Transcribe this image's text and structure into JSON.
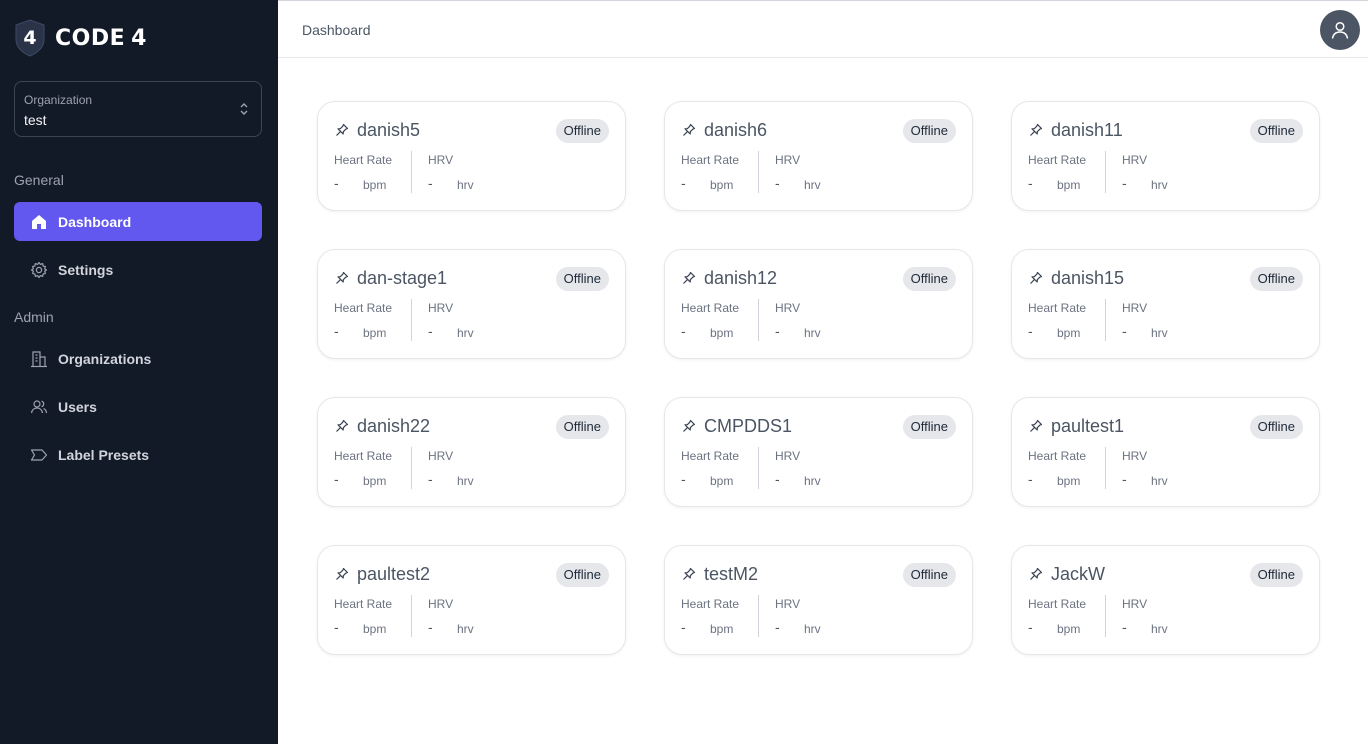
{
  "brand": {
    "name": "CODE",
    "number": "4"
  },
  "org_selector": {
    "label": "Organization",
    "value": "test"
  },
  "sidebar": {
    "general_title": "General",
    "admin_title": "Admin",
    "items": [
      {
        "label": "Dashboard",
        "icon": "home-icon"
      },
      {
        "label": "Settings",
        "icon": "gear-icon"
      },
      {
        "label": "Organizations",
        "icon": "building-icon"
      },
      {
        "label": "Users",
        "icon": "users-icon"
      },
      {
        "label": "Label Presets",
        "icon": "tag-icon"
      }
    ]
  },
  "header": {
    "breadcrumb": "Dashboard"
  },
  "metric_labels": {
    "heart_rate": "Heart Rate",
    "hrv": "HRV",
    "bpm": "bpm",
    "hrv_unit": "hrv"
  },
  "devices": [
    {
      "name": "danish5",
      "status": "Offline",
      "heart_rate": "-",
      "hrv": "-"
    },
    {
      "name": "danish6",
      "status": "Offline",
      "heart_rate": "-",
      "hrv": "-"
    },
    {
      "name": "danish11",
      "status": "Offline",
      "heart_rate": "-",
      "hrv": "-"
    },
    {
      "name": "dan-stage1",
      "status": "Offline",
      "heart_rate": "-",
      "hrv": "-"
    },
    {
      "name": "danish12",
      "status": "Offline",
      "heart_rate": "-",
      "hrv": "-"
    },
    {
      "name": "danish15",
      "status": "Offline",
      "heart_rate": "-",
      "hrv": "-"
    },
    {
      "name": "danish22",
      "status": "Offline",
      "heart_rate": "-",
      "hrv": "-"
    },
    {
      "name": "CMPDDS1",
      "status": "Offline",
      "heart_rate": "-",
      "hrv": "-"
    },
    {
      "name": "paultest1",
      "status": "Offline",
      "heart_rate": "-",
      "hrv": "-"
    },
    {
      "name": "paultest2",
      "status": "Offline",
      "heart_rate": "-",
      "hrv": "-"
    },
    {
      "name": "testM2",
      "status": "Offline",
      "heart_rate": "-",
      "hrv": "-"
    },
    {
      "name": "JackW",
      "status": "Offline",
      "heart_rate": "-",
      "hrv": "-"
    }
  ],
  "colors": {
    "sidebar_bg": "#131a27",
    "accent": "#6258f0",
    "badge_bg": "#e5e7eb"
  }
}
